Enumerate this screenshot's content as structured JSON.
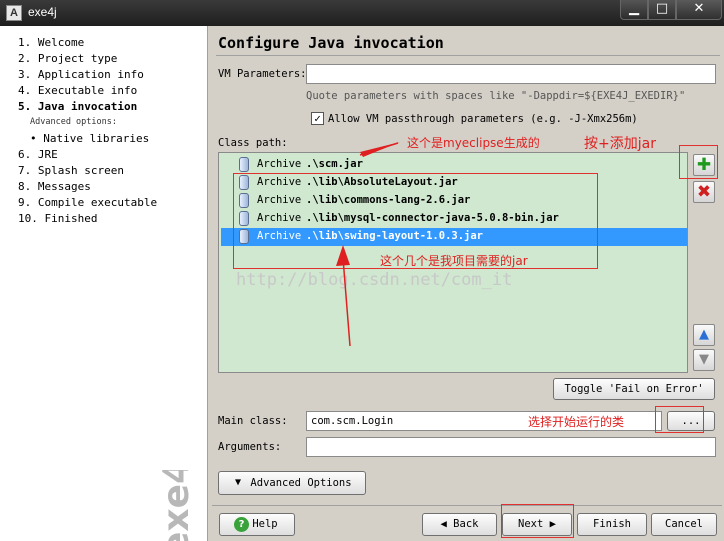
{
  "window": {
    "title": "exe4j",
    "min_symbol": "▁",
    "max_symbol": "□",
    "close_symbol": "✕"
  },
  "nav": {
    "items": [
      {
        "label": "1.  Welcome"
      },
      {
        "label": "2.  Project type"
      },
      {
        "label": "3.  Application info"
      },
      {
        "label": "4.  Executable info"
      },
      {
        "label": "5.  Java invocation"
      },
      {
        "label": "Advanced options:"
      },
      {
        "label": "• Native libraries"
      },
      {
        "label": "6.  JRE"
      },
      {
        "label": "7.  Splash screen"
      },
      {
        "label": "8.  Messages"
      },
      {
        "label": "9.  Compile executable"
      },
      {
        "label": "10.  Finished"
      }
    ],
    "brand": "exe4j"
  },
  "page": {
    "title": "Configure Java invocation"
  },
  "vm": {
    "label": "VM Parameters:",
    "value": "",
    "hint": "Quote parameters with spaces like \"-Dappdir=${EXE4J_EXEDIR}\"",
    "passthrough_label": "Allow VM passthrough parameters (e.g. -J-Xmx256m)",
    "passthrough_checked": "✓"
  },
  "classpath": {
    "label": "Class path:",
    "entries": [
      {
        "type": "Archive",
        "path": ".\\scm.jar"
      },
      {
        "type": "Archive",
        "path": ".\\lib\\AbsoluteLayout.jar"
      },
      {
        "type": "Archive",
        "path": ".\\lib\\commons-lang-2.6.jar"
      },
      {
        "type": "Archive",
        "path": ".\\lib\\mysql-connector-java-5.0.8-bin.jar"
      },
      {
        "type": "Archive",
        "path": ".\\lib\\swing-layout-1.0.3.jar"
      }
    ],
    "add_symbol": "✚",
    "remove_symbol": "✖",
    "up_symbol": "▲",
    "down_symbol": "▼",
    "toggle_label": "Toggle 'Fail on Error'"
  },
  "main_class": {
    "label": "Main class:",
    "value": "com.scm.Login",
    "browse_label": "..."
  },
  "arguments": {
    "label": "Arguments:",
    "value": ""
  },
  "buttons": {
    "advanced": "Advanced Options",
    "help": "Help",
    "help_icon": "?",
    "back": "◀  Back",
    "next": "Next  ▶",
    "finish": "Finish",
    "cancel": "Cancel"
  },
  "annotations": {
    "myeclipse_note": "这个是myeclipse生成的",
    "add_jar_note": "按+添加jar",
    "project_jars_note": "这个几个是我项目需要的jar",
    "main_class_note": "选择开始运行的类",
    "watermark": "http://blog.csdn.net/com_it",
    "color": "#e02020"
  }
}
